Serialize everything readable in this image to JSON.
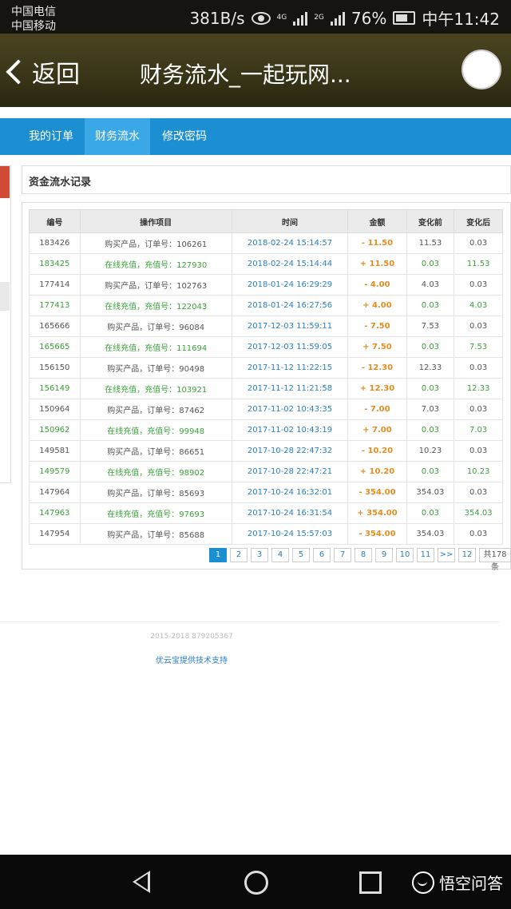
{
  "status_bar": {
    "carrier1": "中国电信",
    "carrier2": "中国移动",
    "speed": "381B/s",
    "network1": "4G",
    "network2": "2G",
    "battery": "76%",
    "time": "中午11:42"
  },
  "header": {
    "back_label": "返回",
    "title": "财务流水_一起玩网..."
  },
  "tabs": [
    {
      "label": "我的订单"
    },
    {
      "label": "财务流水",
      "active": true
    },
    {
      "label": "修改密码"
    }
  ],
  "panel_title": "资金流水记录",
  "table": {
    "headers": [
      "编号",
      "操作项目",
      "时间",
      "金额",
      "变化前",
      "变化后"
    ],
    "rows": [
      {
        "id": "183426",
        "op": "购买产品，订单号：106261",
        "time": "2018-02-24 15:14:57",
        "amount": "- 11.50",
        "before": "11.53",
        "after": "0.03"
      },
      {
        "id": "183425",
        "op": "在线充值，充值号：127930",
        "time": "2018-02-24 15:14:44",
        "amount": "+ 11.50",
        "before": "0.03",
        "after": "11.53"
      },
      {
        "id": "177414",
        "op": "购买产品，订单号：102763",
        "time": "2018-01-24 16:29:29",
        "amount": "- 4.00",
        "before": "4.03",
        "after": "0.03"
      },
      {
        "id": "177413",
        "op": "在线充值，充值号：122043",
        "time": "2018-01-24 16:27:56",
        "amount": "+ 4.00",
        "before": "0.03",
        "after": "4.03"
      },
      {
        "id": "165666",
        "op": "购买产品，订单号：96084",
        "time": "2017-12-03 11:59:11",
        "amount": "- 7.50",
        "before": "7.53",
        "after": "0.03"
      },
      {
        "id": "165665",
        "op": "在线充值，充值号：111694",
        "time": "2017-12-03 11:59:05",
        "amount": "+ 7.50",
        "before": "0.03",
        "after": "7.53"
      },
      {
        "id": "156150",
        "op": "购买产品，订单号：90498",
        "time": "2017-11-12 11:22:15",
        "amount": "- 12.30",
        "before": "12.33",
        "after": "0.03"
      },
      {
        "id": "156149",
        "op": "在线充值，充值号：103921",
        "time": "2017-11-12 11:21:58",
        "amount": "+ 12.30",
        "before": "0.03",
        "after": "12.33"
      },
      {
        "id": "150964",
        "op": "购买产品，订单号：87462",
        "time": "2017-11-02 10:43:35",
        "amount": "- 7.00",
        "before": "7.03",
        "after": "0.03"
      },
      {
        "id": "150962",
        "op": "在线充值，充值号：99948",
        "time": "2017-11-02 10:43:19",
        "amount": "+ 7.00",
        "before": "0.03",
        "after": "7.03"
      },
      {
        "id": "149581",
        "op": "购买产品，订单号：86651",
        "time": "2017-10-28 22:47:32",
        "amount": "- 10.20",
        "before": "10.23",
        "after": "0.03"
      },
      {
        "id": "149579",
        "op": "在线充值，充值号：98902",
        "time": "2017-10-28 22:47:21",
        "amount": "+ 10.20",
        "before": "0.03",
        "after": "10.23"
      },
      {
        "id": "147964",
        "op": "购买产品，订单号：85693",
        "time": "2017-10-24 16:32:01",
        "amount": "- 354.00",
        "before": "354.03",
        "after": "0.03"
      },
      {
        "id": "147963",
        "op": "在线充值，充值号：97693",
        "time": "2017-10-24 16:31:54",
        "amount": "+ 354.00",
        "before": "0.03",
        "after": "354.03"
      },
      {
        "id": "147954",
        "op": "购买产品，订单号：85688",
        "time": "2017-10-24 15:57:03",
        "amount": "- 354.00",
        "before": "354.03",
        "after": "0.03"
      }
    ]
  },
  "pagination": {
    "pages": [
      "1",
      "2",
      "3",
      "4",
      "5",
      "6",
      "7",
      "8",
      "9",
      "10",
      "11",
      ">>",
      "12"
    ],
    "active": "1",
    "total": "共178条"
  },
  "footer": {
    "copyright": "2015-2018 879205367",
    "support": "优云宝提供技术支持"
  },
  "watermark": "悟空问答",
  "colors": {
    "tab_bar": "#1c8fd3",
    "recharge_green": "#3aa23a",
    "time_blue": "#2a7fbf",
    "amount_orange": "#e38c1f"
  }
}
